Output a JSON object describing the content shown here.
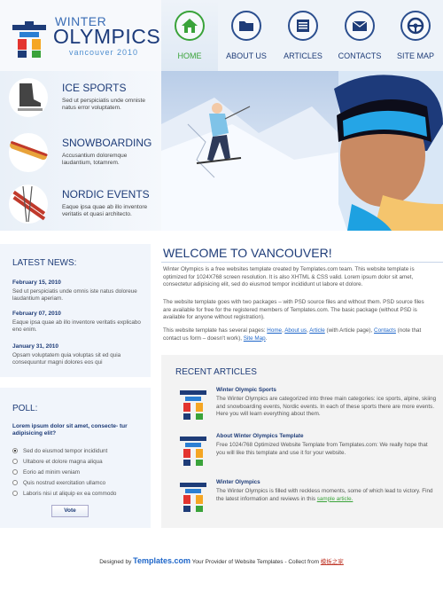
{
  "logo": {
    "winter": "WINTER",
    "olympics": "OLYMPICS",
    "sub": "vancouver 2010"
  },
  "nav": [
    {
      "label": "HOME",
      "icon": "home-icon"
    },
    {
      "label": "ABOUT US",
      "icon": "folder-icon"
    },
    {
      "label": "ARTICLES",
      "icon": "document-icon"
    },
    {
      "label": "CONTACTS",
      "icon": "envelope-icon"
    },
    {
      "label": "SITE MAP",
      "icon": "steering-wheel-icon"
    }
  ],
  "sports": [
    {
      "title": "ICE SPORTS",
      "desc": "Sed ut perspiciatis unde omniste natus error voluptatem."
    },
    {
      "title": "SNOWBOARDING",
      "desc": "Accusantium doloremque laudantium, totamrem."
    },
    {
      "title": "NORDIC EVENTS",
      "desc": "Eaque ipsa quae ab illo inventore veritatis et quasi architecto."
    }
  ],
  "news": {
    "title": "LATEST NEWS:",
    "items": [
      {
        "date": "February 15, 2010",
        "text": "Sed ut perspiciatis unde omnis iste natus doloreue laudantium aperiam."
      },
      {
        "date": "February 07, 2010",
        "text": "Eaque ipsa quae ab illo inventore veritatis explicabo eno enim."
      },
      {
        "date": "January 31, 2010",
        "text": "Opsam voluptatem quia voluptas sit ed quia consequuntur magni dolores eos qui"
      }
    ]
  },
  "poll": {
    "title": "POLL:",
    "question": "Lorem ipsum dolor sit amet, consecte- tur adipisicing elit?",
    "options": [
      "Sed do eiusmod tempor incididunt",
      "Ultabore et dolore magna aliqua",
      "Eorio ad minim veniam",
      "Quis nostrud exercitation ullamco",
      "Laboris nisi ut aliquip ex ea commodo"
    ],
    "selected_index": 0,
    "vote": "Vote"
  },
  "welcome": {
    "title": "WELCOME TO VANCOUVER!",
    "p1": "Winter Olympics is a free websites template created by Templates.com team. This website template is optimized for 1024X768 screen resolution. It is also XHTML & CSS valid. Lorem ipsum dolor sit amet, consectetur adipisicing elit, sed do eiusmod tempor incididunt ut labore et dolore.",
    "p2": "The website template goes with two packages – with PSD source files and without them. PSD source files are available for free for the registered members of Templates.com. The basic package (without PSD is available for anyone without registration).",
    "p3_before": "This website template has several pages: ",
    "p3_links": [
      "Home",
      "About us",
      "Article",
      "Contacts",
      "Site Map"
    ],
    "p3_mid1": " (with Article page), ",
    "p3_mid2": " (note that contact us form – doesn't work), "
  },
  "recent": {
    "title": "RECENT ARTICLES",
    "items": [
      {
        "title": "Winter Olympic Sports",
        "text": "The Winter Olympics are categorized into three main categories: ice sports, alpine, skiing and snowboarding events, Nordic events. In each of these sports there are more events. Here you will learn everything about them.",
        "link": ""
      },
      {
        "title": "About Winter Olympics Template",
        "text": "Free 1024/768 Optimized Website Template from Templates.com: We really hope that you will like this template and use it for your website.",
        "link": ""
      },
      {
        "title": "Winter Olympics",
        "text": "The Winter Olympics is filled with reckless moments, some of which lead to victory. Find the latest information and reviews in this ",
        "link": "sample article."
      }
    ]
  },
  "footer": {
    "before": "Designed by ",
    "brand": "Templates.com",
    "after": " Your Provider of Website Templates - Collect from ",
    "link": "模板之家"
  },
  "colors": {
    "navy": "#1e3c78",
    "green": "#3aa33a",
    "link_blue": "#1e66c9",
    "panel_bg": "#f1f5fb"
  }
}
